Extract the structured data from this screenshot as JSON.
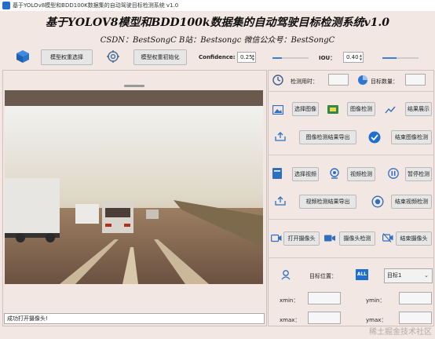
{
  "window": {
    "title": "基于YOLOv8模型和BDD100K数据集的自动驾驶目标检测系统 v1.0",
    "overlay_text": "稀土掘金技术社区"
  },
  "header": {
    "title": "基于YOLOV8模型和BDD100k数据集的自动驾驶目标检测系统v1.0",
    "subtitle": "CSDN：BestSongC   B站：Bestsongc   微信公众号：BestSongC"
  },
  "toolbar": {
    "select_weights_label": "模型权重选择",
    "init_weights_label": "模型权重初始化",
    "confidence_label": "Confidence:",
    "confidence_value": "0.25",
    "confidence_fraction": 0.25,
    "iou_label": "IOU：",
    "iou_value": "0.40",
    "iou_fraction": 0.4
  },
  "stats": {
    "detect_time_label": "检测用时：",
    "detect_time_value": "",
    "target_count_label": "目标数量：",
    "target_count_value": ""
  },
  "image_section": {
    "select_image": "选择图像",
    "detect_image": "图像检测",
    "show_result": "结果展示",
    "export_image_result": "图像检测结果导出",
    "end_image_detect": "结束图像检测"
  },
  "video_section": {
    "select_video": "选择视频",
    "detect_video": "视频检测",
    "pause_detect": "暂停检测",
    "export_video_result": "视频检测结果导出",
    "end_video_detect": "结束视频检测"
  },
  "camera_section": {
    "open_camera": "打开摄像头",
    "camera_detect": "摄像头检测",
    "close_camera": "结束摄像头"
  },
  "target_section": {
    "position_label": "目标位置：",
    "all_badge": "ALL",
    "target_select": "目标1",
    "xmin_label": "xmin：",
    "ymin_label": "ymin：",
    "xmax_label": "xmax：",
    "ymax_label": "ymax：",
    "xmin_value": "",
    "ymin_value": "",
    "xmax_value": "",
    "ymax_value": ""
  },
  "status_bar": {
    "message": "成功打开摄像头!"
  },
  "colors": {
    "background": "#f3e7e3",
    "accent": "#1e6fd0",
    "slider_fill": "#3d7fd6"
  }
}
